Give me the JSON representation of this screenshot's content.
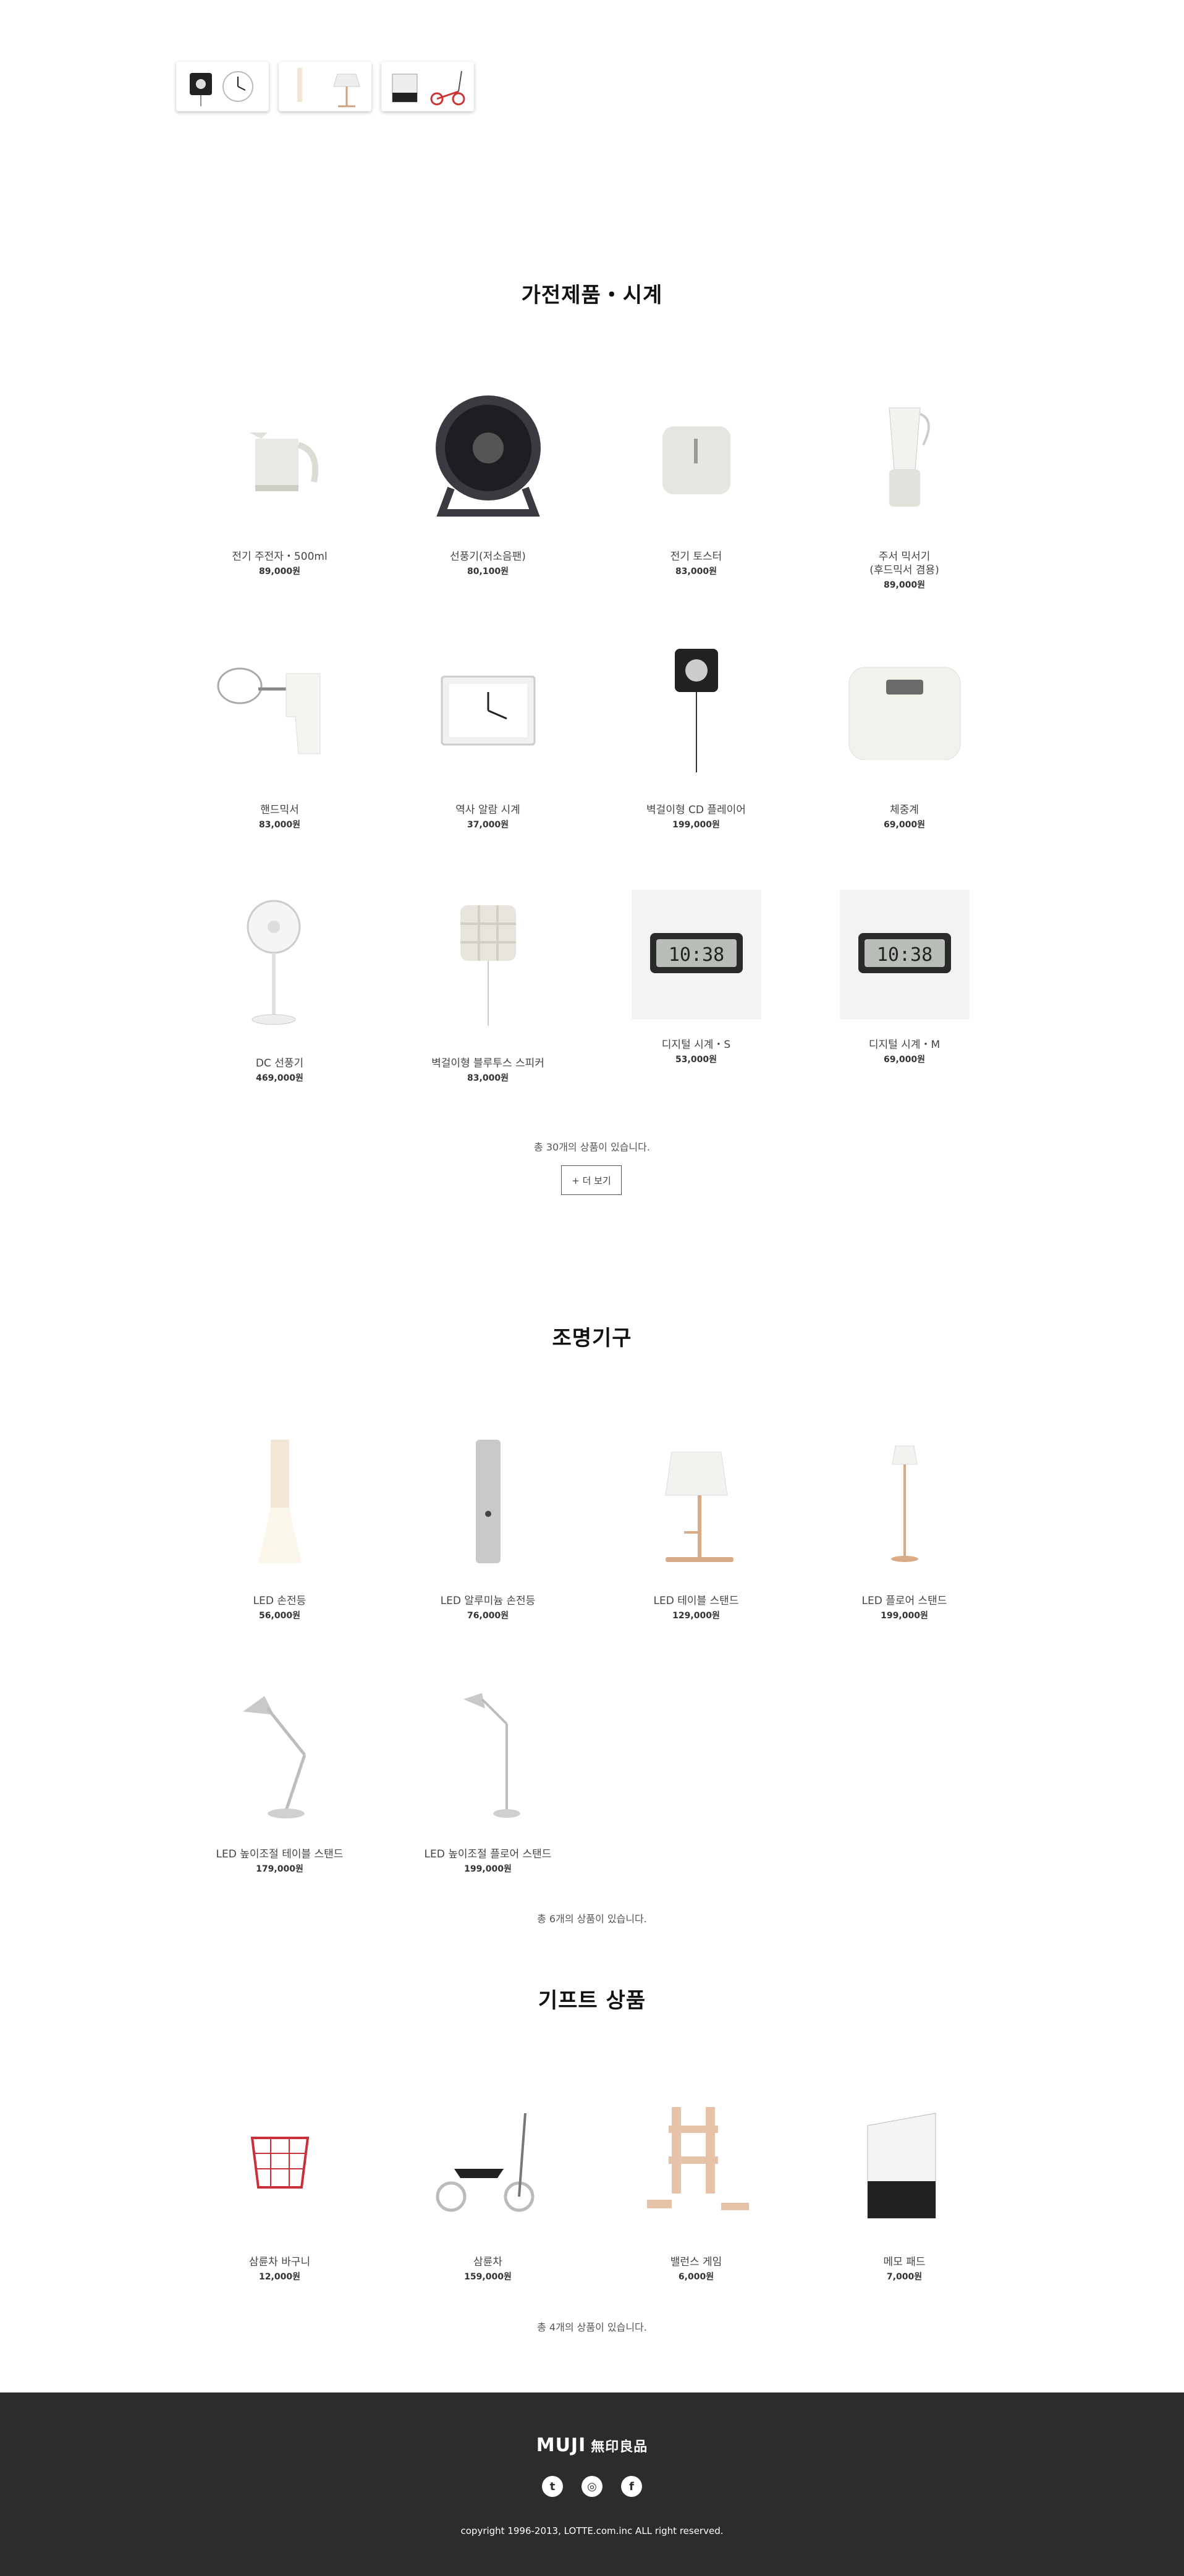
{
  "sections": [
    {
      "title": "가전제품・시계",
      "items": [
        {
          "name": "전기 주전자・500ml",
          "price": "89,000원",
          "icon": "kettle-icon"
        },
        {
          "name": "선풍기(저소음팬)",
          "price": "80,100원",
          "icon": "fan-icon"
        },
        {
          "name": "전기 토스터",
          "price": "83,000원",
          "icon": "toaster-icon"
        },
        {
          "name": "주서 믹서기\n(후드믹서 겸용)",
          "price": "89,000원",
          "icon": "blender-icon"
        },
        {
          "name": "핸드믹서",
          "price": "83,000원",
          "icon": "hand-mixer-icon"
        },
        {
          "name": "역사 알람 시계",
          "price": "37,000원",
          "icon": "clock-icon"
        },
        {
          "name": "벽걸이형 CD 플레이어",
          "price": "199,000원",
          "icon": "cd-player-icon"
        },
        {
          "name": "체중계",
          "price": "69,000원",
          "icon": "scale-icon"
        },
        {
          "name": "DC 선풍기",
          "price": "469,000원",
          "icon": "stand-fan-icon"
        },
        {
          "name": "벽걸이형 블루투스 스피커",
          "price": "83,000원",
          "icon": "speaker-icon"
        },
        {
          "name": "디지털 시계・S",
          "price": "53,000원",
          "icon": "digital-clock-icon"
        },
        {
          "name": "디지털 시계・M",
          "price": "69,000원",
          "icon": "digital-clock-icon"
        }
      ],
      "count_text": "총 30개의 상품이 있습니다.",
      "more_label": "+ 더 보기"
    },
    {
      "title": "조명기구",
      "items": [
        {
          "name": "LED 손전등",
          "price": "56,000원",
          "icon": "lantern-icon"
        },
        {
          "name": "LED 알루미늄 손전등",
          "price": "76,000원",
          "icon": "flashlight-icon"
        },
        {
          "name": "LED 테이블 스탠드",
          "price": "129,000원",
          "icon": "table-lamp-icon"
        },
        {
          "name": "LED 플로어 스탠드",
          "price": "199,000원",
          "icon": "floor-lamp-icon"
        },
        {
          "name": "LED 높이조절 테이블 스탠드",
          "price": "179,000원",
          "icon": "desk-lamp-icon"
        },
        {
          "name": "LED 높이조절 플로어 스탠드",
          "price": "199,000원",
          "icon": "arm-floor-lamp-icon"
        }
      ],
      "count_text": "총 6개의 상품이 있습니다."
    },
    {
      "title": "기프트 상품",
      "items": [
        {
          "name": "삼륜차 바구니",
          "price": "12,000원",
          "icon": "basket-icon"
        },
        {
          "name": "삼륜차",
          "price": "159,000원",
          "icon": "tricycle-icon"
        },
        {
          "name": "밸런스 게임",
          "price": "6,000원",
          "icon": "blocks-icon"
        },
        {
          "name": "메모 패드",
          "price": "7,000원",
          "icon": "memo-pad-icon"
        }
      ],
      "count_text": "총 4개의 상품이 있습니다."
    }
  ],
  "footer": {
    "logo": "MUJI",
    "logo_kanji": "無印良品",
    "social": [
      {
        "name": "twitter-icon",
        "glyph": "t"
      },
      {
        "name": "instagram-icon",
        "glyph": "◎"
      },
      {
        "name": "facebook-icon",
        "glyph": "f"
      }
    ],
    "copyright": "copyright 1996-2013, LOTTE.com.inc ALL right reserved."
  }
}
